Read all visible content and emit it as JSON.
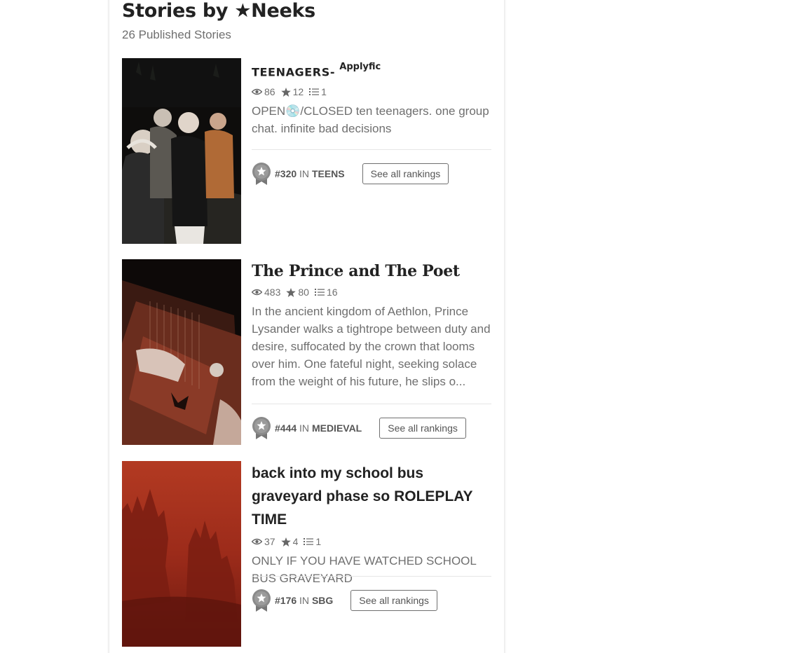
{
  "header": {
    "title": "Stories by ★Neeks",
    "subtitle": "26 Published Stories"
  },
  "stories": [
    {
      "title": "TEENAGERS-",
      "title_sup": "Applyfic",
      "reads": "86",
      "votes": "12",
      "parts": "1",
      "description": "OPEN💿/CLOSED ten teenagers. one group chat. infinite bad decisions",
      "rank_number": "#320",
      "rank_in": "IN",
      "rank_tag": "TEENS",
      "rankings_button": "See all rankings"
    },
    {
      "title": "The Prince and The Poet",
      "reads": "483",
      "votes": "80",
      "parts": "16",
      "description": "In the ancient kingdom of Aethlon, Prince Lysander walks a tightrope between duty and desire, suffocated by the crown that looms over him. One fateful night, seeking solace from the weight of his future, he slips o...",
      "rank_number": "#444",
      "rank_in": "IN",
      "rank_tag": "MEDIEVAL",
      "rankings_button": "See all rankings"
    },
    {
      "title": "back into my school bus graveyard phase so ROLEPLAY TIME",
      "reads": "37",
      "votes": "4",
      "parts": "1",
      "description": "ONLY IF YOU HAVE WATCHED SCHOOL BUS GRAVEYARD",
      "rank_number": "#176",
      "rank_in": "IN",
      "rank_tag": "SBG",
      "rankings_button": "See all rankings"
    }
  ],
  "icons": {
    "reads": "eye-icon",
    "votes": "star-icon",
    "parts": "list-icon",
    "rank": "medal-icon"
  },
  "colors": {
    "text_muted": "#6f6f6f",
    "title": "#222222",
    "divider": "#e6e6e6"
  }
}
